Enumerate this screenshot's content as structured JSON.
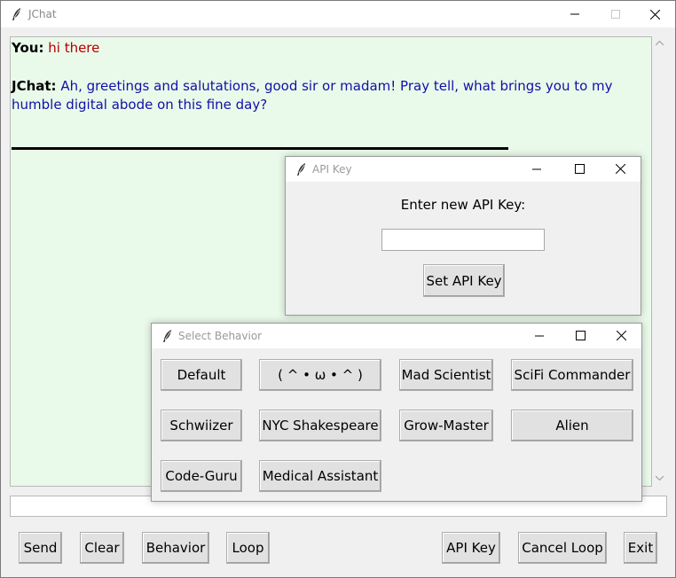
{
  "window": {
    "title": "JChat"
  },
  "chat": {
    "messages": [
      {
        "speaker": "You:",
        "text": "hi there"
      },
      {
        "speaker": "JChat:",
        "text": "Ah, greetings and salutations, good sir or madam! Pray tell, what brings you to my humble digital abode on this fine day?"
      }
    ]
  },
  "bottom_buttons": {
    "send": "Send",
    "clear": "Clear",
    "behavior": "Behavior",
    "loop": "Loop",
    "api_key": "API Key",
    "cancel_loop": "Cancel Loop",
    "exit": "Exit"
  },
  "api_dialog": {
    "title": "API Key",
    "prompt": "Enter new API Key:",
    "input_value": "",
    "set_button": "Set API Key"
  },
  "behavior_dialog": {
    "title": "Select Behavior",
    "options": [
      "Default",
      "( ^ • ω • ^ )",
      "Mad Scientist",
      "SciFi Commander",
      "Schwiizer",
      "NYC Shakespeare",
      "Grow-Master",
      "Alien",
      "Code-Guru",
      "Medical Assistant"
    ]
  },
  "colors": {
    "chat_background": "#eafaea",
    "user_text": "#b40000",
    "bot_text": "#1010a8"
  }
}
